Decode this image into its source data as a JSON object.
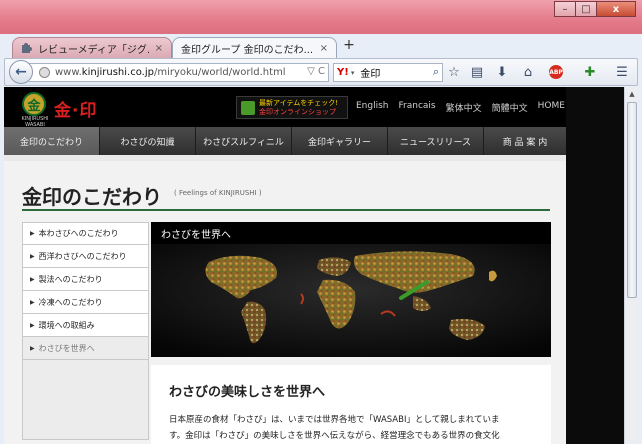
{
  "window": {
    "minimize": "–",
    "maximize": "□",
    "close": "x"
  },
  "tabs": [
    {
      "label": "レビューメディア「ジグ...",
      "close": "×"
    },
    {
      "label": "金印グループ 金印のこだわ...",
      "close": "×"
    }
  ],
  "newtab": "+",
  "navbar": {
    "back": "←",
    "url_prefix": "www.",
    "url_domain": "kinjirushi.co.jp",
    "url_path": "/miryoku/world/world.html",
    "url_controls": "▽ C",
    "search_value": "金印",
    "search_provider": "Y!",
    "search_icon": "⌕",
    "icons": [
      "star-icon",
      "reader-icon",
      "download-icon",
      "home-icon",
      "adblock-icon",
      "addon-icon",
      "menu-icon"
    ],
    "adblock_label": "ABP"
  },
  "site": {
    "logo_seal": "金",
    "logo_caption": "KINJIRUSHI WASABI",
    "logo_text": "金·印",
    "shop_line1": "最新アイテムをチェック!",
    "shop_line2": "金印オンラインショップ",
    "languages": [
      "English",
      "Francais",
      "繁体中文",
      "簡體中文",
      "HOME"
    ],
    "main_nav": [
      "金印のこだわり",
      "わさびの知識",
      "わさびスルフィニル",
      "金印ギャラリー",
      "ニュースリリース",
      "商 品 案 内"
    ],
    "page_title": "金印のこだわり",
    "page_subtitle": "( Feelings of KINJIRUSHI )",
    "side_nav": [
      {
        "label": "本わさびへのこだわり",
        "arrow": "▶"
      },
      {
        "label": "西洋わさびへのこだわり",
        "arrow": "▶"
      },
      {
        "label": "製法へのこだわり",
        "arrow": "▶"
      },
      {
        "label": "冷凍へのこだわり",
        "arrow": "▶"
      },
      {
        "label": "環境への取組み",
        "arrow": "▶"
      },
      {
        "label": "わさびを世界へ",
        "arrow": "▶"
      }
    ],
    "section_title": "わさびを世界へ",
    "article_heading": "わさびの美味しさを世界へ",
    "article_line1": "日本原産の食材「わさび」は、いまでは世界各地で「WASABI」として親しまれていま",
    "article_line2": "す。金印は「わさび」の美味しさを世界へ伝えながら、経営理念でもある世界の食文化"
  },
  "colors": {
    "accent_green": "#2d6a3a",
    "brand_red": "#d92020",
    "nav_dark": "#2f2f2f"
  }
}
